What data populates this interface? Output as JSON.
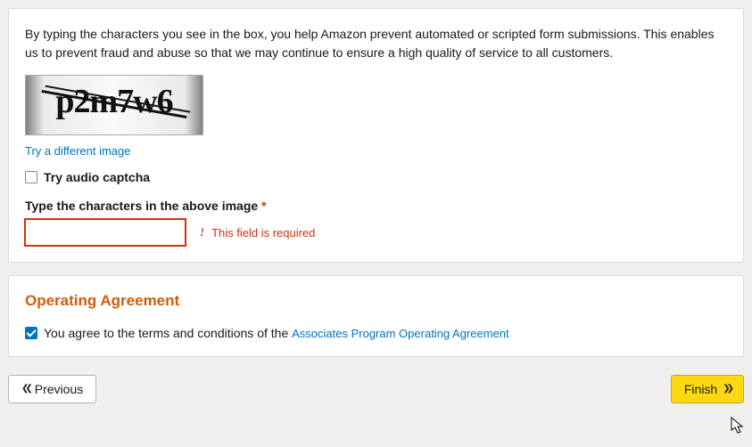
{
  "captcha": {
    "intro": "By typing the characters you see in the box, you help Amazon prevent automated or scripted form submissions. This enables us to prevent fraud and abuse so that we may continue to ensure a high quality of service to all customers.",
    "imageText": "p2m7w6",
    "differentImageLink": "Try a different image",
    "audioLabel": "Try audio captcha",
    "fieldLabel": "Type the characters in the above image",
    "requiredMark": "*",
    "errorText": "This field is required",
    "value": ""
  },
  "agreement": {
    "title": "Operating Agreement",
    "agreePrefix": "You agree to the terms and conditions of the ",
    "agreeLink": "Associates Program Operating Agreement",
    "checked": true
  },
  "buttons": {
    "previous": "Previous",
    "finish": "Finish"
  }
}
